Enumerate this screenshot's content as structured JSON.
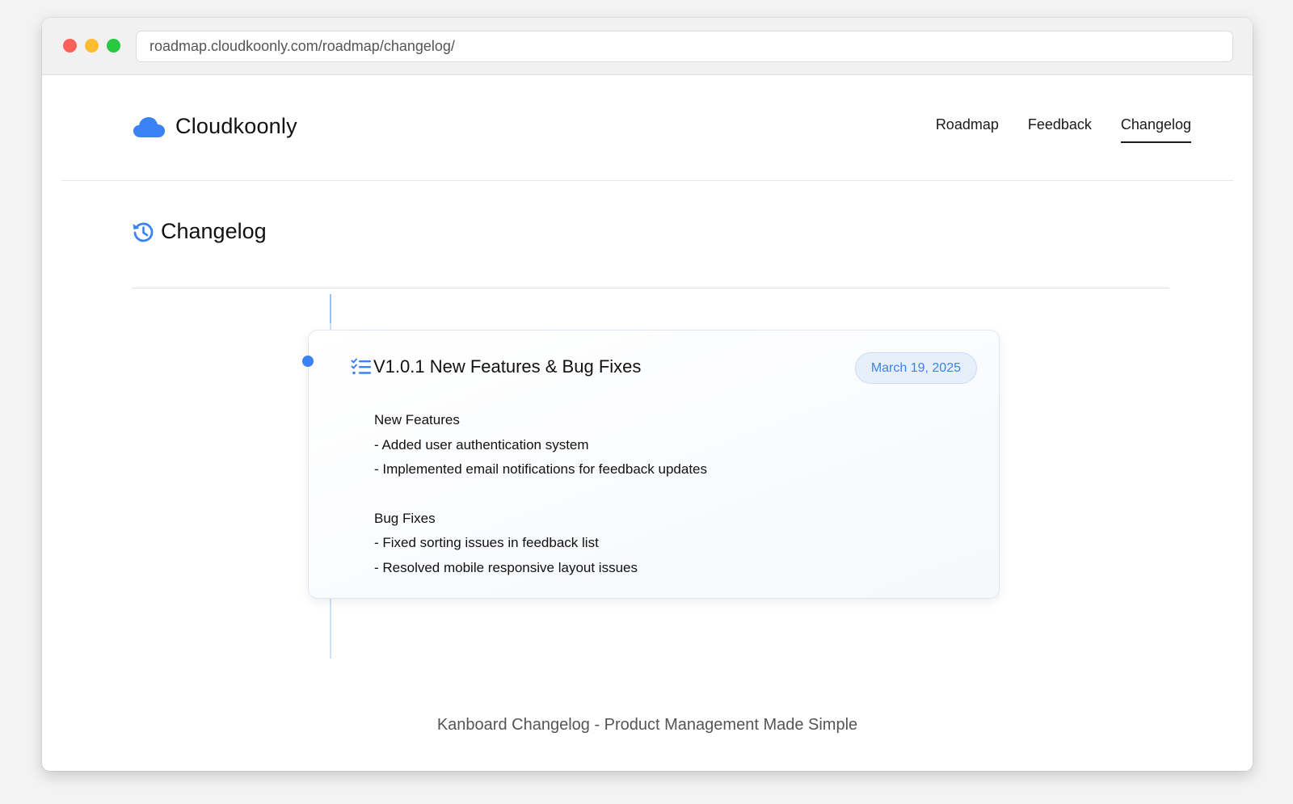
{
  "browser": {
    "url": "roadmap.cloudkoonly.com/roadmap/changelog/"
  },
  "header": {
    "brand": "Cloudkoonly",
    "nav": [
      {
        "label": "Roadmap",
        "active": false
      },
      {
        "label": "Feedback",
        "active": false
      },
      {
        "label": "Changelog",
        "active": true
      }
    ]
  },
  "page": {
    "title": "Changelog",
    "title_icon": "history-icon"
  },
  "entries": [
    {
      "icon": "checklist-icon",
      "title": "V1.0.1 New Features & Bug Fixes",
      "date": "March 19, 2025",
      "sections": [
        {
          "heading": "New Features",
          "items": [
            "- Added user authentication system",
            "- Implemented email notifications for feedback updates"
          ]
        },
        {
          "heading": "Bug Fixes",
          "items": [
            "- Fixed sorting issues in feedback list",
            "- Resolved mobile responsive layout issues"
          ]
        }
      ]
    }
  ],
  "footer": {
    "text": "Kanboard Changelog - Product Management Made Simple"
  },
  "colors": {
    "accent": "#3b82f6",
    "badge_bg": "#e7effb",
    "timeline": "#cfe0f7"
  }
}
